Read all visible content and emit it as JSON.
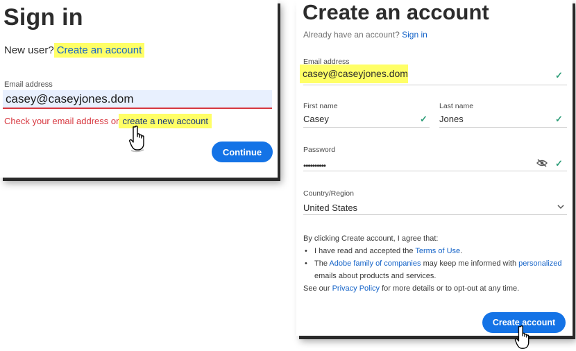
{
  "signin": {
    "title": "Sign in",
    "new_user_prefix": "New user?",
    "create_account_link": "Create an account",
    "email_label": "Email address",
    "email_value": "casey@caseyjones.dom",
    "error_prefix": "Check your email address or",
    "error_link": "create a new account",
    "continue_label": "Continue"
  },
  "create": {
    "title": "Create an account",
    "have_account_text": "Already have an account?",
    "sign_in_link": "Sign in",
    "email_label": "Email address",
    "email_value": "casey@caseyjones.dom",
    "first_name_label": "First name",
    "first_name_value": "Casey",
    "last_name_label": "Last name",
    "last_name_value": "Jones",
    "password_label": "Password",
    "password_mask": "••••••••••",
    "country_label": "Country/Region",
    "country_value": "United States",
    "terms_intro": "By clicking Create account, I agree that:",
    "terms_item1_prefix": "I have read and accepted the",
    "terms_item1_link": "Terms of Use",
    "terms_item1_suffix": ".",
    "terms_item2_prefix": "The",
    "terms_item2_link1": "Adobe family of companies",
    "terms_item2_mid": "may keep me informed with",
    "terms_item2_link2": "personalized",
    "terms_item2_suffix": "emails about products and services.",
    "terms_footer_prefix": "See our",
    "terms_footer_link": "Privacy Policy",
    "terms_footer_suffix": "for more details or to opt-out at any time.",
    "create_button_label": "Create account"
  },
  "colors": {
    "accent": "#1473e6",
    "error": "#d7373f",
    "highlight": "#ffff66",
    "success": "#2d9d78"
  },
  "icons": {
    "check": "check-icon",
    "eye": "eye-hidden-icon",
    "chevron": "chevron-down-icon",
    "cursor": "hand-pointer-icon"
  }
}
